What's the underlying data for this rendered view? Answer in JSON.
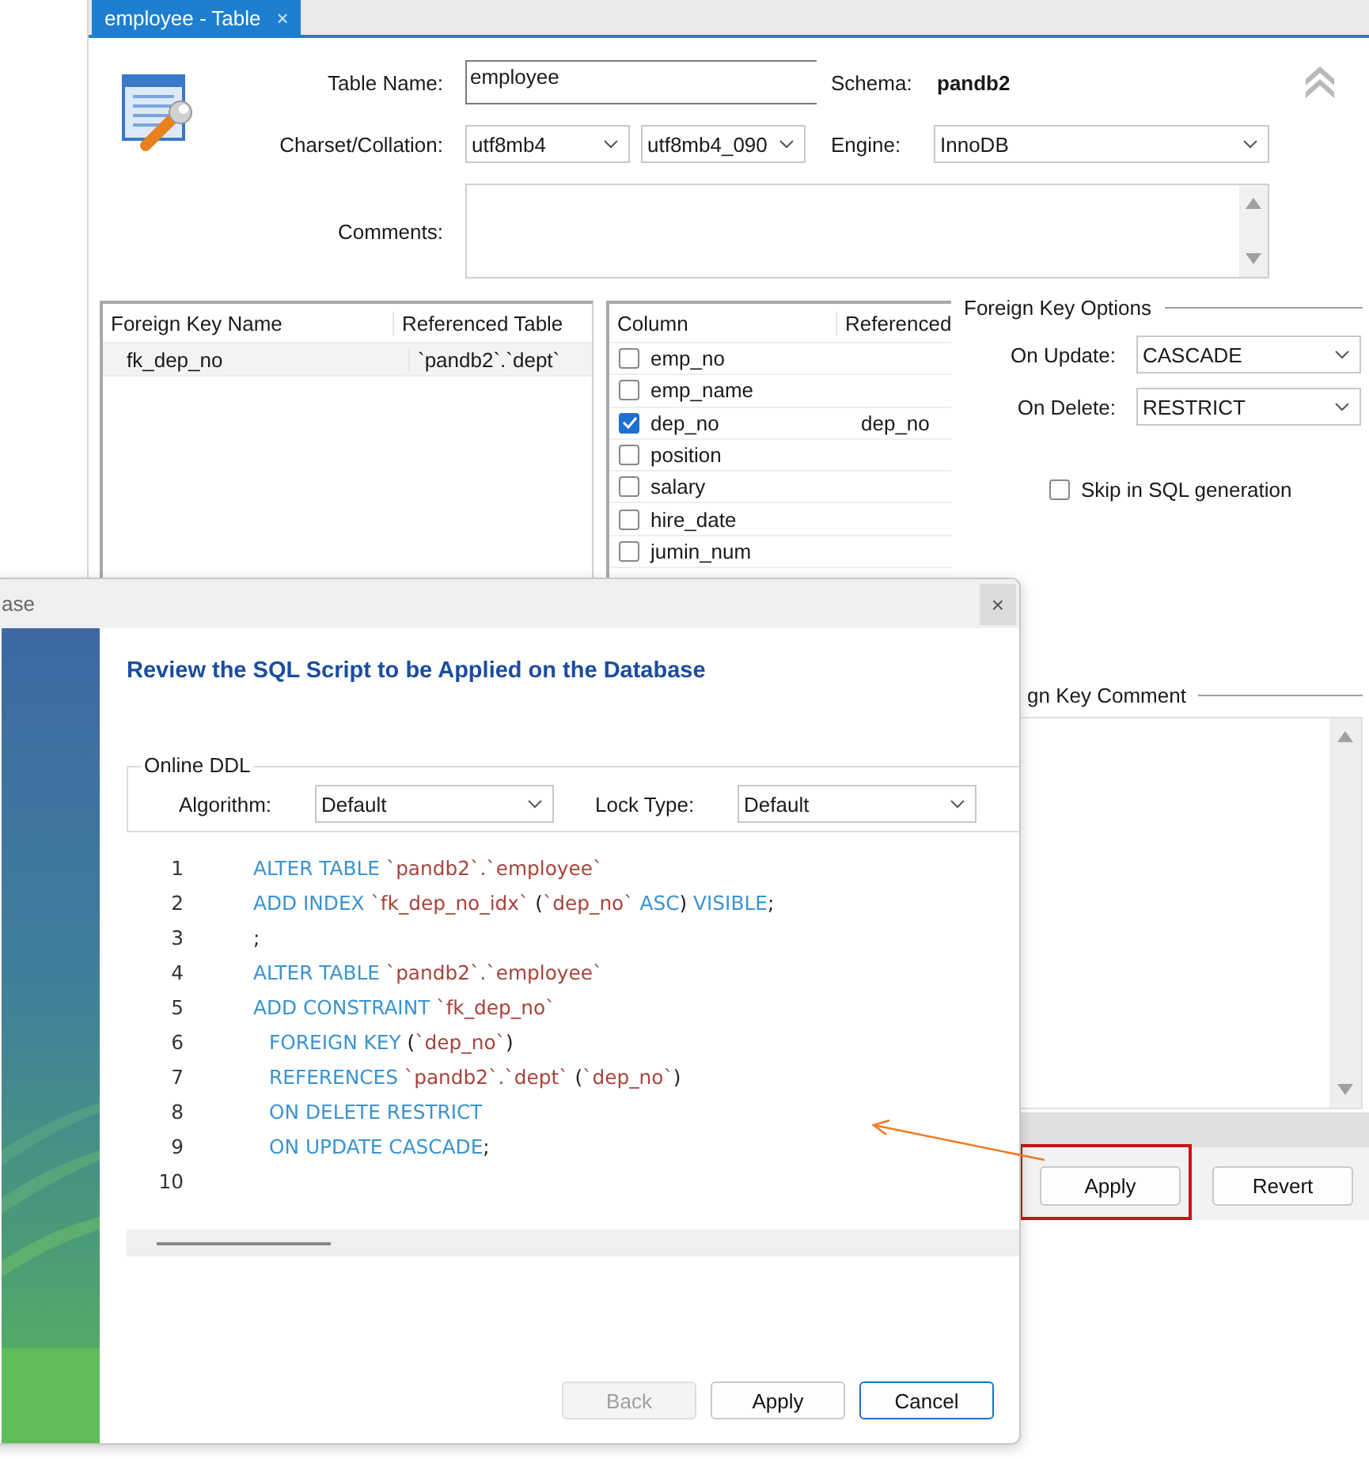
{
  "editor_tab": {
    "label": "employee - Table",
    "close": "×",
    "selected": true
  },
  "table_form": {
    "table_name_label": "Table Name:",
    "table_name": "employee",
    "schema_label": "Schema:",
    "schema": "pandb2",
    "charset_label": "Charset/Collation:",
    "charset": "utf8mb4",
    "collation": "utf8mb4_090",
    "engine_label": "Engine:",
    "engine": "InnoDB",
    "comments_label": "Comments:"
  },
  "fk_table": {
    "columns": [
      "Foreign Key Name",
      "Referenced Table"
    ],
    "rows": [
      {
        "cells": [
          "fk_dep_no",
          "`pandb2`.`dept`"
        ],
        "selected": true
      }
    ]
  },
  "column_table": {
    "columns": [
      "Column",
      "Referenced"
    ],
    "rows": [
      {
        "name": "emp_no",
        "checked": false
      },
      {
        "name": "emp_name",
        "checked": false
      },
      {
        "name": "dep_no",
        "checked": true,
        "referenced": "dep_no"
      },
      {
        "name": "position",
        "checked": false
      },
      {
        "name": "salary",
        "checked": false
      },
      {
        "name": "hire_date",
        "checked": false
      },
      {
        "name": "jumin_num",
        "checked": false
      }
    ]
  },
  "fk_options": {
    "title": "Foreign Key Options",
    "on_update_label": "On Update:",
    "on_update": "CASCADE",
    "on_delete_label": "On Delete:",
    "on_delete": "RESTRICT",
    "skip_label": "Skip in SQL generation",
    "skip_checked": false
  },
  "fk_comment": {
    "title": "gn Key Comment"
  },
  "footer_buttons": [
    {
      "label": "Apply",
      "highlighted": true
    },
    {
      "label": "Revert",
      "highlighted": false
    }
  ],
  "dialog": {
    "title": "ase",
    "close": "×",
    "heading": "Review the SQL Script to be Applied on the Database",
    "online_ddl": {
      "title": "Online DDL",
      "algorithm_label": "Algorithm:",
      "algorithm": "Default",
      "lock_label": "Lock Type:",
      "lock": "Default"
    },
    "lines": [
      {
        "number": "1",
        "indent": false,
        "tokens": [
          {
            "kind": "kw",
            "text": "ALTER TABLE "
          },
          {
            "kind": "id",
            "text": "`pandb2`.`employee`"
          }
        ]
      },
      {
        "number": "2",
        "indent": false,
        "tokens": [
          {
            "kind": "kw",
            "text": "ADD INDEX "
          },
          {
            "kind": "id",
            "text": "`fk_dep_no_idx`"
          },
          {
            "kind": "p",
            "text": " ("
          },
          {
            "kind": "id",
            "text": "`dep_no`"
          },
          {
            "kind": "kw",
            "text": " ASC"
          },
          {
            "kind": "p",
            "text": ") "
          },
          {
            "kind": "kw",
            "text": "VISIBLE"
          },
          {
            "kind": "p",
            "text": ";"
          }
        ]
      },
      {
        "number": "3",
        "indent": false,
        "tokens": [
          {
            "kind": "p",
            "text": ";"
          }
        ]
      },
      {
        "number": "4",
        "indent": false,
        "tokens": [
          {
            "kind": "kw",
            "text": "ALTER TABLE "
          },
          {
            "kind": "id",
            "text": "`pandb2`.`employee`"
          }
        ]
      },
      {
        "number": "5",
        "indent": false,
        "tokens": [
          {
            "kind": "kw",
            "text": "ADD CONSTRAINT "
          },
          {
            "kind": "id",
            "text": "`fk_dep_no`"
          }
        ]
      },
      {
        "number": "6",
        "indent": true,
        "tokens": [
          {
            "kind": "kw",
            "text": "FOREIGN KEY "
          },
          {
            "kind": "p",
            "text": "("
          },
          {
            "kind": "id",
            "text": "`dep_no`"
          },
          {
            "kind": "p",
            "text": ")"
          }
        ]
      },
      {
        "number": "7",
        "indent": true,
        "tokens": [
          {
            "kind": "kw",
            "text": "REFERENCES "
          },
          {
            "kind": "id",
            "text": "`pandb2`.`dept`"
          },
          {
            "kind": "p",
            "text": " ("
          },
          {
            "kind": "id",
            "text": "`dep_no`"
          },
          {
            "kind": "p",
            "text": ")"
          }
        ]
      },
      {
        "number": "8",
        "indent": true,
        "tokens": [
          {
            "kind": "kw",
            "text": "ON DELETE RESTRICT"
          }
        ]
      },
      {
        "number": "9",
        "indent": true,
        "tokens": [
          {
            "kind": "kw",
            "text": "ON UPDATE CASCADE"
          },
          {
            "kind": "p",
            "text": ";"
          }
        ]
      },
      {
        "number": "10"
      }
    ],
    "buttons": [
      {
        "label": "Back",
        "disabled": true,
        "kind": "plain"
      },
      {
        "label": "Apply",
        "disabled": false,
        "kind": "plain"
      },
      {
        "label": "Cancel",
        "disabled": false,
        "kind": "default"
      }
    ]
  }
}
